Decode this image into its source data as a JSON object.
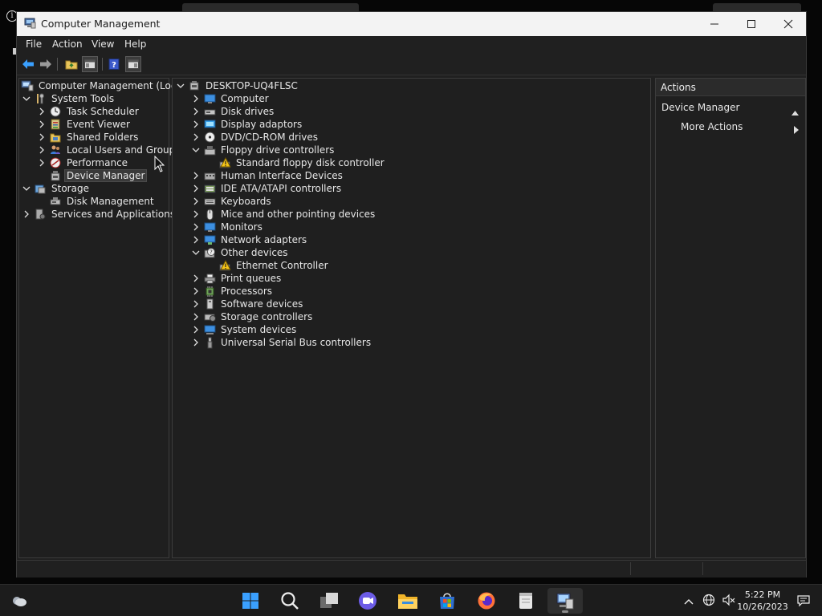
{
  "window": {
    "title": "Computer Management"
  },
  "menu": [
    "File",
    "Action",
    "View",
    "Help"
  ],
  "left_tree": [
    {
      "label": "Computer Management (Local)",
      "icon": "computer-management-icon",
      "twisty": ""
    },
    {
      "label": "System Tools",
      "icon": "system-tools-icon",
      "twisty": "expanded"
    },
    {
      "label": "Task Scheduler",
      "icon": "clock-icon",
      "twisty": "collapsed"
    },
    {
      "label": "Event Viewer",
      "icon": "event-viewer-icon",
      "twisty": "collapsed"
    },
    {
      "label": "Shared Folders",
      "icon": "shared-folder-icon",
      "twisty": "collapsed"
    },
    {
      "label": "Local Users and Groups",
      "icon": "users-icon",
      "twisty": "collapsed"
    },
    {
      "label": "Performance",
      "icon": "performance-icon",
      "twisty": "collapsed"
    },
    {
      "label": "Device Manager",
      "icon": "device-manager-icon",
      "twisty": "",
      "selected": true
    },
    {
      "label": "Storage",
      "icon": "storage-icon",
      "twisty": "expanded"
    },
    {
      "label": "Disk Management",
      "icon": "disk-management-icon",
      "twisty": ""
    },
    {
      "label": "Services and Applications",
      "icon": "services-icon",
      "twisty": "collapsed"
    }
  ],
  "device_tree": {
    "root": "DESKTOP-UQ4FLSC",
    "items": [
      {
        "label": "Computer",
        "icon": "monitor-icon",
        "twisty": "collapsed"
      },
      {
        "label": "Disk drives",
        "icon": "disk-drive-icon",
        "twisty": "collapsed"
      },
      {
        "label": "Display adaptors",
        "icon": "display-adapter-icon",
        "twisty": "collapsed"
      },
      {
        "label": "DVD/CD-ROM drives",
        "icon": "dvd-icon",
        "twisty": "collapsed"
      },
      {
        "label": "Floppy drive controllers",
        "icon": "floppy-controller-icon",
        "twisty": "expanded"
      },
      {
        "label": "Standard floppy disk controller",
        "icon": "warning-device-icon",
        "twisty": ""
      },
      {
        "label": "Human Interface Devices",
        "icon": "hid-icon",
        "twisty": "collapsed"
      },
      {
        "label": "IDE ATA/ATAPI controllers",
        "icon": "ide-controller-icon",
        "twisty": "collapsed"
      },
      {
        "label": "Keyboards",
        "icon": "keyboard-icon",
        "twisty": "collapsed"
      },
      {
        "label": "Mice and other pointing devices",
        "icon": "mouse-icon",
        "twisty": "collapsed"
      },
      {
        "label": "Monitors",
        "icon": "monitor-icon",
        "twisty": "collapsed"
      },
      {
        "label": "Network adapters",
        "icon": "network-adapter-icon",
        "twisty": "collapsed"
      },
      {
        "label": "Other devices",
        "icon": "unknown-device-icon",
        "twisty": "expanded"
      },
      {
        "label": "Ethernet Controller",
        "icon": "warning-device-icon",
        "twisty": ""
      },
      {
        "label": "Print queues",
        "icon": "printer-icon",
        "twisty": "collapsed"
      },
      {
        "label": "Processors",
        "icon": "processor-icon",
        "twisty": "collapsed"
      },
      {
        "label": "Software devices",
        "icon": "software-device-icon",
        "twisty": "collapsed"
      },
      {
        "label": "Storage controllers",
        "icon": "storage-controller-icon",
        "twisty": "collapsed"
      },
      {
        "label": "System devices",
        "icon": "system-devices-icon",
        "twisty": "collapsed"
      },
      {
        "label": "Universal Serial Bus controllers",
        "icon": "usb-icon",
        "twisty": "collapsed"
      }
    ]
  },
  "actions": {
    "header": "Actions",
    "section": "Device Manager",
    "more": "More Actions"
  },
  "taskbar": {
    "time": "5:22 PM",
    "date": "10/26/2023",
    "apps": [
      "start-icon",
      "search-icon",
      "task-view-icon",
      "meet-icon",
      "file-explorer-icon",
      "store-icon",
      "firefox-icon",
      "notepad-icon",
      "computer-management-icon"
    ]
  },
  "colors": {
    "window_bg": "#202020",
    "titlebar_bg": "#f3f3f3",
    "selection_bg": "#3a3a3a",
    "taskbar_bg": "#1c1c1c"
  }
}
